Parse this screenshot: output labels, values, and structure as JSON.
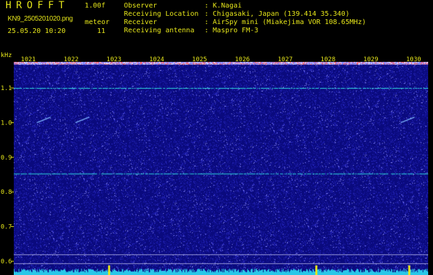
{
  "header": {
    "app_title": "HROFFT",
    "version": "1.00f",
    "filename": "KN9_2505201020.png",
    "counter_label": "meteor",
    "timestamp": "25.05.20 10:20",
    "counter_value": "11"
  },
  "info": [
    {
      "label": "Observer",
      "value": ": K.Nagai"
    },
    {
      "label": "Receiving Location",
      "value": ": Chigasaki, Japan (139.414 35.340)"
    },
    {
      "label": "Receiver",
      "value": ": AirSpy mini (Miakejima VOR 108.65MHz)"
    },
    {
      "label": "Receiving antenna",
      "value": ": Maspro FM-3"
    }
  ],
  "colors": {
    "text": "#e6e61a",
    "background": "#000000",
    "plot": "#0a0a7e",
    "noise": "#3a3ac8",
    "carrier": "#2ee0e0",
    "baseline": "#29c7e8"
  },
  "chart_data": {
    "type": "heatmap",
    "ylabel": "kHz",
    "y_ticks": [
      "1.1",
      "1.0",
      "0.9",
      "0.8",
      "0.7",
      "0.6"
    ],
    "y_tick_values": [
      1.1,
      1.0,
      0.9,
      0.8,
      0.7,
      0.6
    ],
    "x_ticks": [
      "1021",
      "1022",
      "1023",
      "1024",
      "1025",
      "1026",
      "1027",
      "1028",
      "1029",
      "1030"
    ],
    "x_tick_values": [
      1021,
      1022,
      1023,
      1024,
      1025,
      1026,
      1027,
      1028,
      1029,
      1030
    ],
    "ylim": [
      0.575,
      1.15
    ],
    "xlim": [
      1020.66,
      1030.34
    ],
    "carrier_lines_khz": [
      1.1,
      0.853
    ],
    "meteor_echoes": [
      {
        "x": 1021.2,
        "y": 1.0
      },
      {
        "x": 1022.1,
        "y": 1.0
      },
      {
        "x": 1029.7,
        "y": 1.0
      }
    ]
  }
}
